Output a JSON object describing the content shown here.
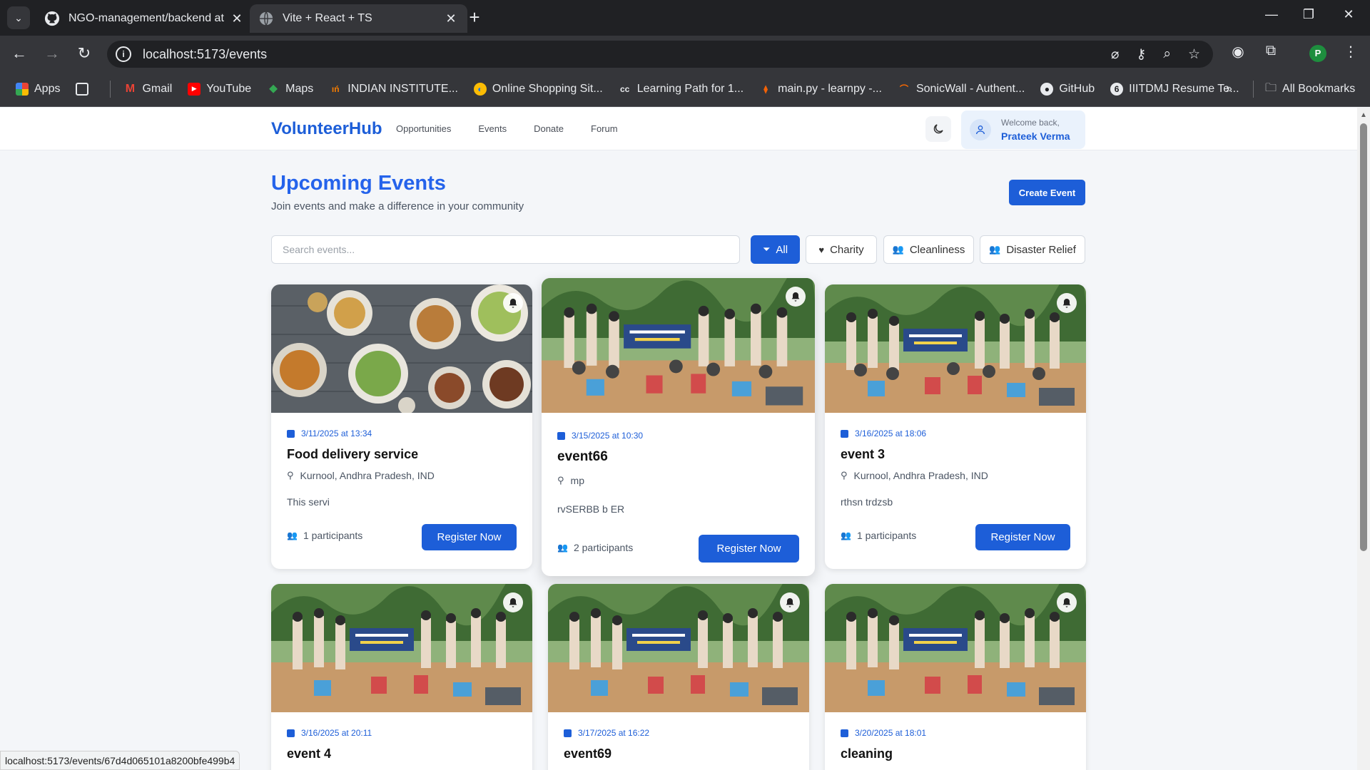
{
  "browser": {
    "tabs": [
      {
        "title": "NGO-management/backend at",
        "icon": "github-icon",
        "active": false
      },
      {
        "title": "Vite + React + TS",
        "icon": "globe-icon",
        "active": true
      }
    ],
    "url": "localhost:5173/events",
    "profile_initial": "P",
    "bookmarks": [
      {
        "label": "Apps",
        "icon": "apps-grid-icon"
      },
      {
        "label": "Gmail",
        "icon": "gmail-icon"
      },
      {
        "label": "YouTube",
        "icon": "youtube-icon"
      },
      {
        "label": "Maps",
        "icon": "maps-icon"
      },
      {
        "label": "INDIAN INSTITUTE...",
        "icon": "institute-icon"
      },
      {
        "label": "Online Shopping Sit...",
        "icon": "shopping-icon"
      },
      {
        "label": "Learning Path for 1...",
        "icon": "cc-icon"
      },
      {
        "label": "main.py - learnpy -...",
        "icon": "replit-icon"
      },
      {
        "label": "SonicWall - Authent...",
        "icon": "sonicwall-icon"
      },
      {
        "label": "GitHub",
        "icon": "github-icon"
      },
      {
        "label": "IIITDMJ Resume Te...",
        "icon": "resume-icon"
      }
    ],
    "all_bookmarks": "All Bookmarks",
    "status_url": "localhost:5173/events/67d4d065101a8200bfe499b4"
  },
  "header": {
    "logo": "VolunteerHub",
    "nav": [
      "Opportunities",
      "Events",
      "Donate",
      "Forum"
    ],
    "welcome": "Welcome back,",
    "user_name": "Prateek Verma"
  },
  "main": {
    "title": "Upcoming Events",
    "subtitle": "Join events and make a difference in your community",
    "create_button": "Create Event",
    "search_placeholder": "Search events...",
    "filters": [
      {
        "label": "All",
        "icon": "filter-icon",
        "active": true
      },
      {
        "label": "Charity",
        "icon": "heart-icon",
        "active": false
      },
      {
        "label": "Cleanliness",
        "icon": "users-icon",
        "active": false
      },
      {
        "label": "Disaster Relief",
        "icon": "users-icon",
        "active": false
      }
    ]
  },
  "events": [
    {
      "date": "3/11/2025 at 13:34",
      "title": "Food delivery service",
      "location": "Kurnool, Andhra Pradesh, IND",
      "description": "This servi",
      "participants": "1 participants",
      "button": "Register Now",
      "image": "food"
    },
    {
      "date": "3/15/2025 at 10:30",
      "title": "event66",
      "location": "mp",
      "description": "rvSERBB b ER",
      "participants": "2 participants",
      "button": "Register Now",
      "image": "camp"
    },
    {
      "date": "3/16/2025 at 18:06",
      "title": "event 3",
      "location": "Kurnool, Andhra Pradesh, IND",
      "description": "rthsn trdzsb",
      "participants": "1 participants",
      "button": "Register Now",
      "image": "camp"
    },
    {
      "date": "3/16/2025 at 20:11",
      "title": "event 4",
      "location": "",
      "description": "",
      "participants": "",
      "button": "",
      "image": "camp"
    },
    {
      "date": "3/17/2025 at 16:22",
      "title": "event69",
      "location": "",
      "description": "",
      "participants": "",
      "button": "",
      "image": "camp"
    },
    {
      "date": "3/20/2025 at 18:01",
      "title": "cleaning",
      "location": "",
      "description": "",
      "participants": "",
      "button": "",
      "image": "camp"
    }
  ],
  "colors": {
    "accent": "#1d5ed8",
    "title": "#2563eb",
    "page_bg": "#f4f6f9"
  }
}
